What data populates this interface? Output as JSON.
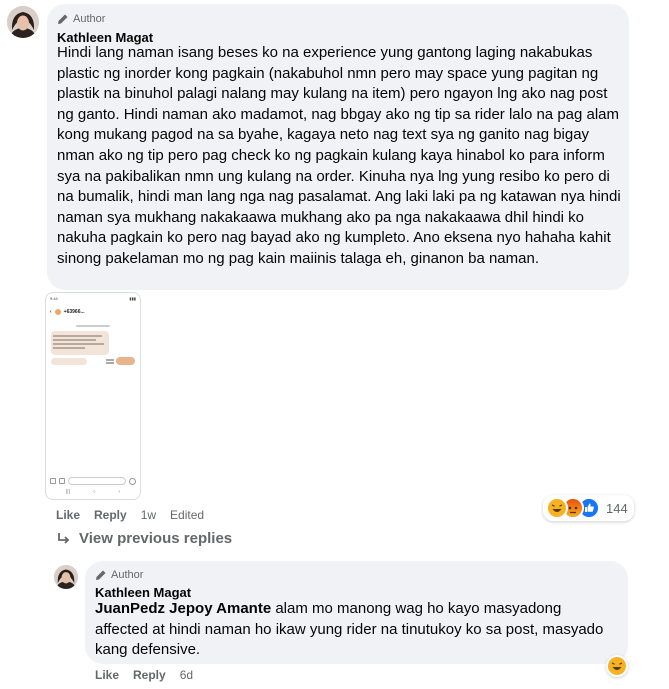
{
  "comment": {
    "author_badge": "Author",
    "author_name": "Kathleen Magat",
    "text": "Hindi lang naman isang beses ko na experience yung gantong laging nakabukas plastic ng inorder kong pagkain (nakabuhol nmn pero may space yung pagitan ng plastik na binuhol palagi nalang may kulang na item) pero ngayon lng ako nag post ng ganto. Hindi naman ako madamot, nag bbgay ako ng tip sa rider lalo na pag alam kong mukang pagod na sa byahe, kagaya neto nag text sya ng ganito nag bigay nman ako ng tip pero pag check ko ng pagkain kulang kaya hinabol ko para inform sya na pakibalikan nmn ung kulang na order. Kinuha nya lng yung resibo ko pero di na bumalik, hindi man lang nga nag pasalamat. Ang laki laki pa ng katawan nya hindi naman sya mukhang nakakaawa mukhang ako pa nga nakakaawa dhil hindi ko nakuha pagkain ko pero nag bayad ako ng kumpleto. Ano eksena nyo hahaha kahit sinong pakelaman mo ng pag kain maiinis talaga eh, ginanon ba naman.",
    "screenshot": {
      "status_time": "9:44",
      "contact": "+63966..."
    },
    "actions": {
      "like": "Like",
      "reply": "Reply",
      "time": "1w",
      "edited": "Edited"
    },
    "reaction_count": "144"
  },
  "view_previous": "View previous replies",
  "reply": {
    "author_badge": "Author",
    "author_name": "Kathleen Magat",
    "mention": "JuanPedz Jepoy Amante",
    "text": " alam mo manong wag ho kayo masyadong affected at hindi naman ho ikaw yung rider na tinutukoy ko sa post, masyado kang defensive.",
    "actions": {
      "like": "Like",
      "reply": "Reply",
      "time": "6d"
    }
  },
  "colors": {
    "bubble": "#f0f2f5",
    "meta": "#65676b",
    "text": "#050505",
    "like": "#1877f2",
    "haha": "#f7b125",
    "angry": "#e9710f"
  }
}
